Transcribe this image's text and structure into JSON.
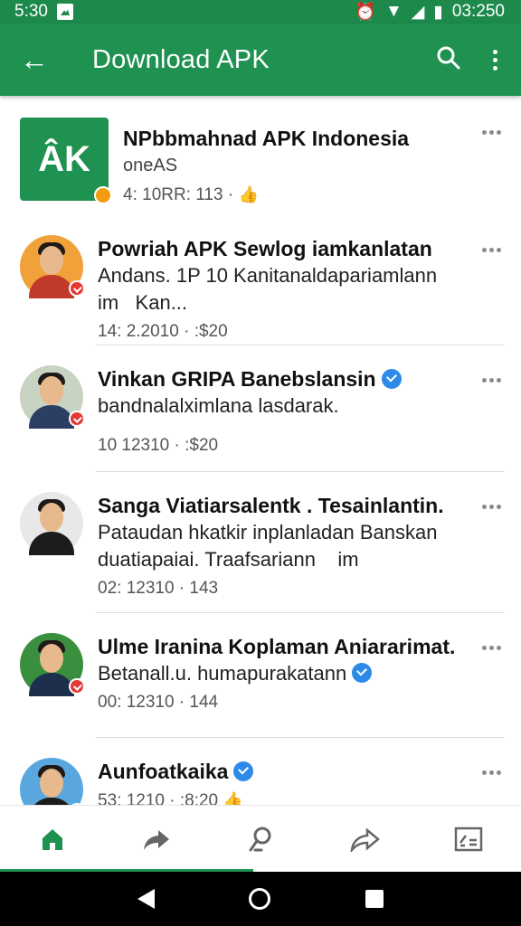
{
  "status": {
    "time": "5:30",
    "right_time": "03:250"
  },
  "appbar": {
    "title": "Download APK"
  },
  "feed": [
    {
      "kind": "app",
      "name": "NPbbmahnad APK Indonesia",
      "subtitle": "oneAS",
      "meta": "4: 10RR: 113 ·",
      "logo_text": "ÂK"
    },
    {
      "kind": "post",
      "name": "Powriah APK Sewlog iamkanlatan",
      "text": "Andans. 1P 10 Kanitanaldapariamlann im   Kan...",
      "meta": "14: 2.2010 · :$20",
      "verified": false
    },
    {
      "kind": "post",
      "name": "Vinkan GRIPA Banebslansin",
      "text": "bandnalalximlana lasdarak.",
      "meta": "10 12310 · :$20",
      "verified": true
    },
    {
      "kind": "post",
      "name": "Sanga Viatiarsalentk . Tesainlantin.",
      "text": "Pataudan hkatkir inplanladan Banskan duatiapaiai. Traafsariann    im",
      "meta": "02: 12310 · 143",
      "verified": false
    },
    {
      "kind": "post",
      "name": "Ulme Iranina Koplaman Aniararimat.",
      "text": "Betanall.u. humapurakatann",
      "meta": "00: 12310 · 144",
      "verified": true
    },
    {
      "kind": "post",
      "name": "Aunfoatkaika",
      "text": "",
      "meta": "53: 1210 · :8:20",
      "verified": true
    }
  ],
  "colors": {
    "primary": "#1f9150",
    "accent": "#2d8ae8"
  }
}
